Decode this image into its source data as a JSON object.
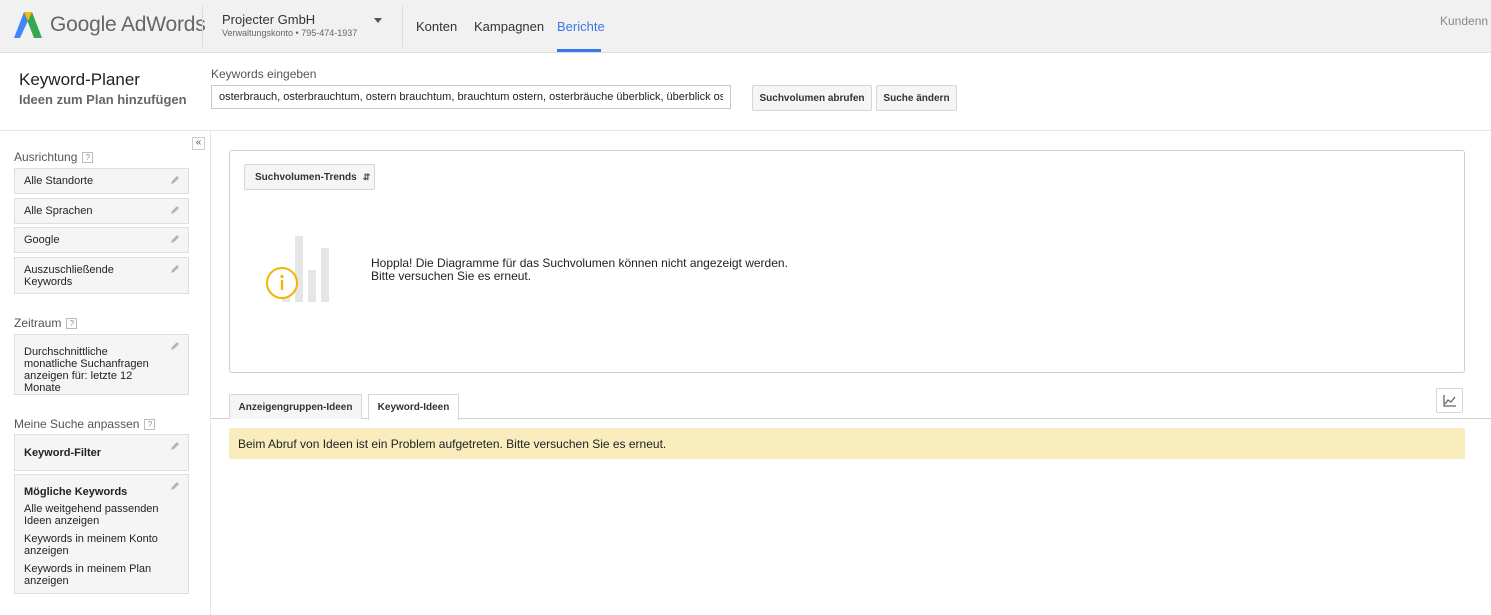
{
  "header": {
    "logo_text": "Google AdWords",
    "account_name": "Projecter GmbH",
    "account_sub": "Verwaltungskonto • 795-474-1937",
    "nav": [
      "Konten",
      "Kampagnen",
      "Berichte"
    ],
    "nav_active": "Berichte",
    "right_text": "Kundenn"
  },
  "planner": {
    "title": "Keyword-Planer",
    "subtitle": "Ideen zum Plan hinzufügen",
    "keywords_label": "Keywords eingeben",
    "keywords_value": "osterbrauch, osterbrauchtum, ostern brauchtum, brauchtum ostern, osterbräuche überblick, überblick oste",
    "btn_volume": "Suchvolumen abrufen",
    "btn_change": "Suche ändern"
  },
  "sidebar": {
    "collapse_label": "«",
    "targeting_title": "Ausrichtung",
    "targeting_items": [
      "Alle Standorte",
      "Alle Sprachen",
      "Google",
      "Auszuschließende Keywords"
    ],
    "period_title": "Zeitraum",
    "period_text": "Durchschnittliche monatliche Suchanfragen anzeigen für: letzte 12 Monate",
    "customize_title": "Meine Suche anpassen",
    "keyword_filter": "Keyword-Filter",
    "possible_keywords_title": "Mögliche Keywords",
    "possible_keywords_items": [
      "Alle weitgehend passenden Ideen anzeigen",
      "Keywords in meinem Konto anzeigen",
      "Keywords in meinem Plan anzeigen"
    ],
    "help_label": "?"
  },
  "main": {
    "trend_dropdown": "Suchvolumen-Trends",
    "error_line1": "Hoppla! Die Diagramme für das Suchvolumen können nicht angezeigt werden.",
    "error_line2": "Bitte versuchen Sie es erneut.",
    "tabs": [
      "Anzeigengruppen-Ideen",
      "Keyword-Ideen"
    ],
    "active_tab": "Keyword-Ideen",
    "warning": "Beim Abruf von Ideen ist ein Problem aufgetreten. Bitte versuchen Sie es erneut."
  },
  "colors": {
    "accent": "#3b78e7",
    "warning_bg": "#f9edbe",
    "info_icon": "#f4b400"
  }
}
